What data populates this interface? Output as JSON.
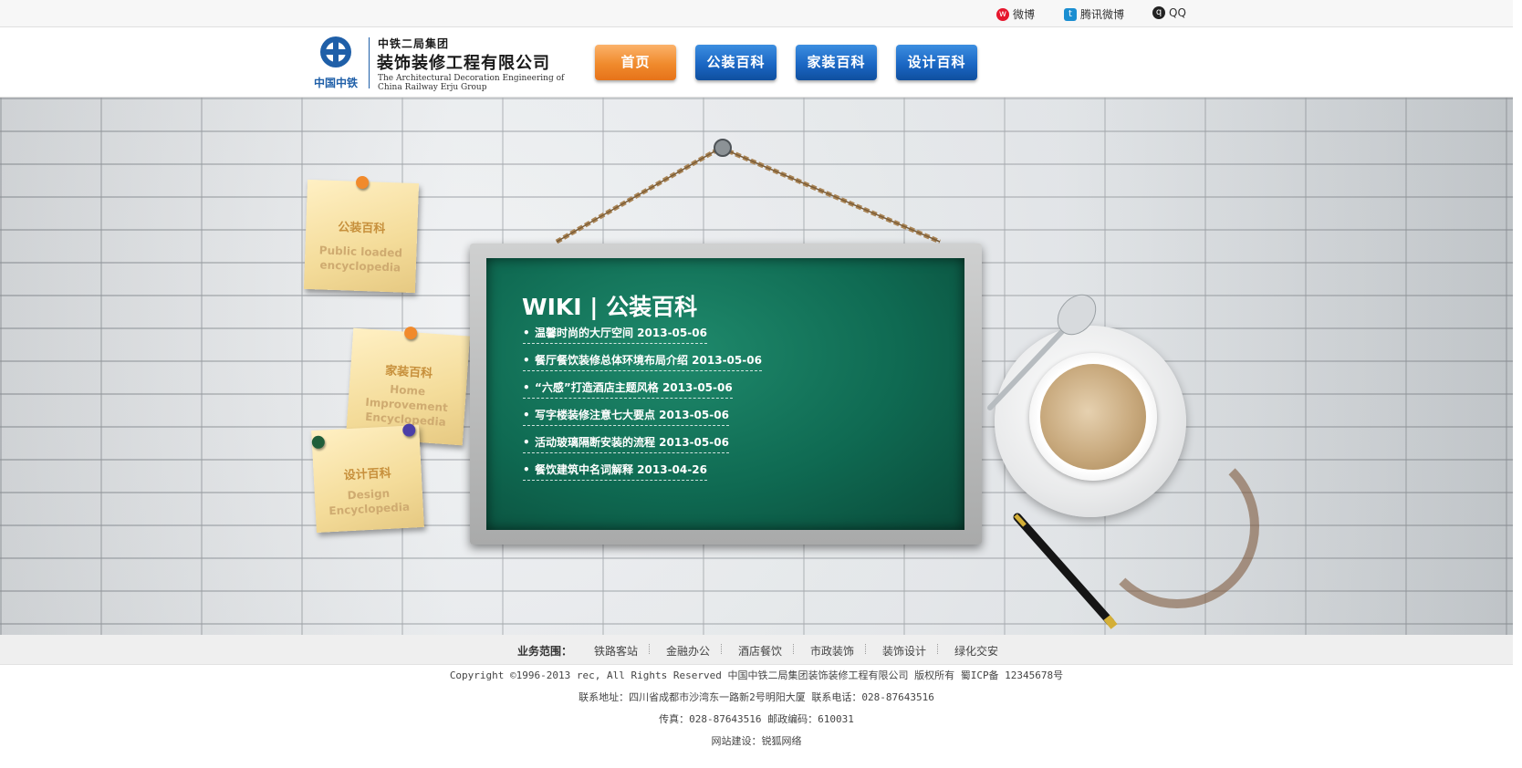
{
  "topbar": {
    "links": [
      {
        "label": "微博",
        "icon": "weibo-icon"
      },
      {
        "label": "腾讯微博",
        "icon": "tencent-weibo-icon"
      },
      {
        "label": "QQ",
        "icon": "qq-icon"
      }
    ]
  },
  "logo": {
    "mark_text": "中国中铁",
    "line1": "中铁二局集团",
    "line2": "装饰装修工程有限公司",
    "line3a": "The Architectural Decoration Engineering of",
    "line3b": "China Railway Erju Group"
  },
  "nav": [
    {
      "label": "首页",
      "active": true
    },
    {
      "label": "公装百科",
      "active": false
    },
    {
      "label": "家装百科",
      "active": false
    },
    {
      "label": "设计百科",
      "active": false
    }
  ],
  "notes": [
    {
      "zh": "公装百科",
      "en1": "Public loaded",
      "en2": "encyclopedia"
    },
    {
      "zh": "家装百科",
      "en1": "Home",
      "en2": "Improvement",
      "en3": "Encyclopedia"
    },
    {
      "zh": "设计百科",
      "en1": "Design",
      "en2": "Encyclopedia"
    }
  ],
  "wiki": {
    "title": "WIKI | 公装百科",
    "items": [
      "温馨时尚的大厅空间 2013-05-06",
      "餐厅餐饮装修总体环境布局介绍 2013-05-06",
      "“六感”打造酒店主题风格 2013-05-06",
      "写字楼装修注意七大要点 2013-05-06",
      "活动玻璃隔断安装的流程 2013-05-06",
      "餐饮建筑中名词解释 2013-04-26"
    ]
  },
  "business": {
    "label": "业务范围：",
    "items": [
      "铁路客站",
      "金融办公",
      "酒店餐饮",
      "市政装饰",
      "装饰设计",
      "绿化交安"
    ]
  },
  "footer": {
    "copyright": "Copyright ©1996-2013 rec, All Rights Reserved 中国中铁二局集团装饰装修工程有限公司 版权所有 蜀ICP备 12345678号",
    "address": "联系地址：四川省成都市沙湾东一路新2号明阳大厦 联系电话：028-87643516",
    "fax": "传真：028-87643516 邮政编码：610031",
    "builder": "网站建设：锐狐网络"
  },
  "colors": {
    "nav_active": "#f08a2c",
    "nav_default": "#1b67c4",
    "chalkboard": "#0f6a52",
    "logo_blue": "#1f5fa8"
  }
}
